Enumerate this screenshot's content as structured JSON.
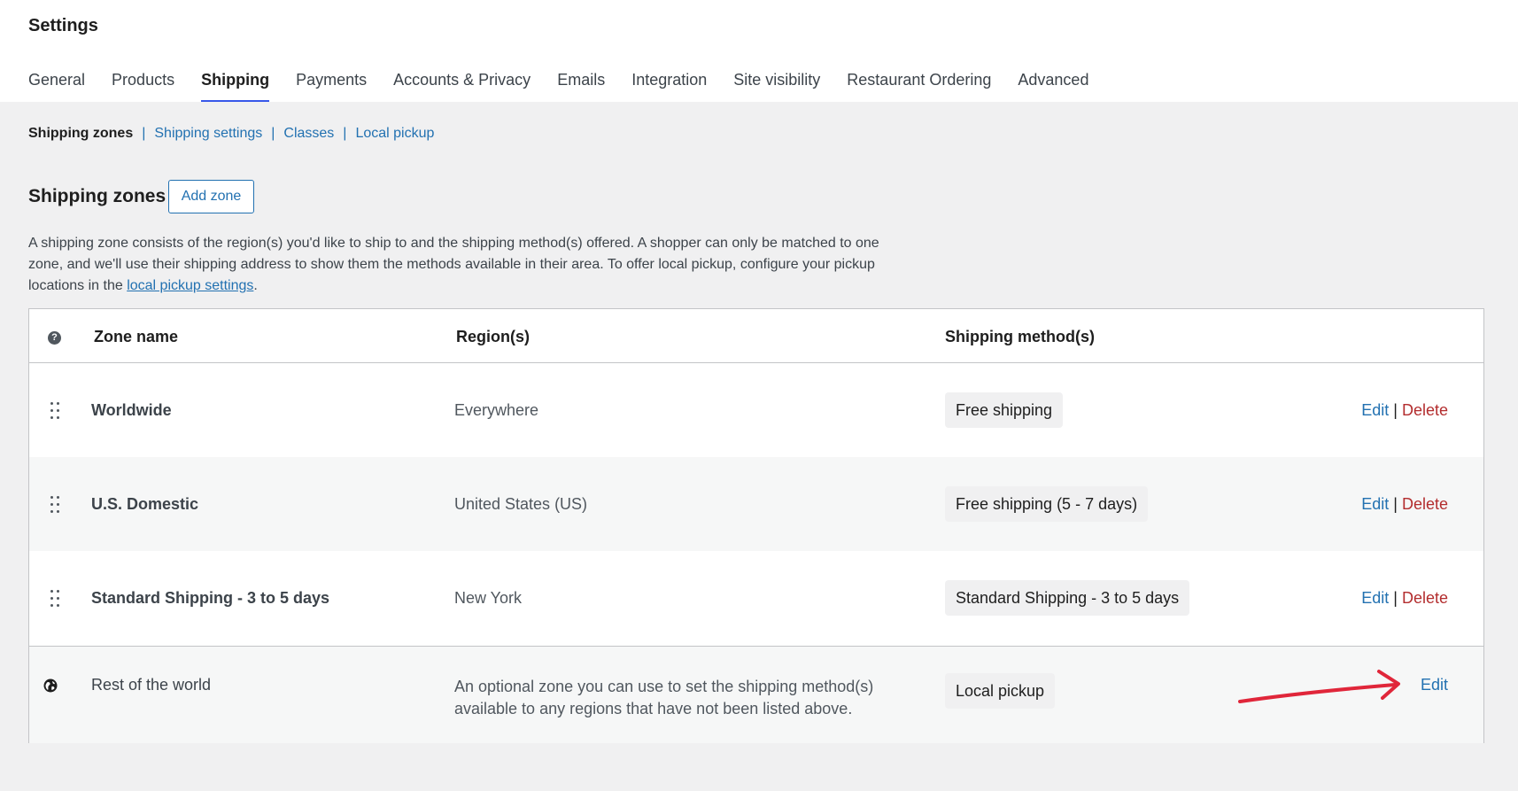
{
  "header": {
    "title": "Settings",
    "tabs": [
      {
        "label": "General"
      },
      {
        "label": "Products"
      },
      {
        "label": "Shipping"
      },
      {
        "label": "Payments"
      },
      {
        "label": "Accounts & Privacy"
      },
      {
        "label": "Emails"
      },
      {
        "label": "Integration"
      },
      {
        "label": "Site visibility"
      },
      {
        "label": "Restaurant Ordering"
      },
      {
        "label": "Advanced"
      }
    ],
    "active_tab": "Shipping"
  },
  "subnav": {
    "current": "Shipping zones",
    "links": [
      "Shipping settings",
      "Classes",
      "Local pickup"
    ]
  },
  "zones": {
    "heading": "Shipping zones",
    "add_zone_label": "Add zone",
    "description_before_link": "A shipping zone consists of the region(s) you'd like to ship to and the shipping method(s) offered. A shopper can only be matched to one zone, and we'll use their shipping address to show them the methods available in their area. To offer local pickup, configure your pickup locations in the ",
    "description_link": "local pickup settings",
    "description_after_link": "."
  },
  "table": {
    "columns": {
      "zone_name": "Zone name",
      "regions": "Region(s)",
      "methods": "Shipping method(s)"
    },
    "rows": [
      {
        "zone_name": "Worldwide",
        "region": "Everywhere",
        "method": "Free shipping",
        "edit": "Edit",
        "delete": "Delete"
      },
      {
        "zone_name": "U.S. Domestic",
        "region": "United States (US)",
        "method": "Free shipping (5 - 7 days)",
        "edit": "Edit",
        "delete": "Delete"
      },
      {
        "zone_name": "Standard Shipping - 3 to 5 days",
        "region": "New York",
        "method": "Standard Shipping - 3 to 5 days",
        "edit": "Edit",
        "delete": "Delete"
      }
    ],
    "rest_of_world": {
      "zone_name": "Rest of the world",
      "region": "An optional zone you can use to set the shipping method(s) available to any regions that have not been listed above.",
      "method": "Local pickup",
      "edit": "Edit"
    }
  },
  "colors": {
    "link": "#2271b1",
    "delete": "#b32d2e",
    "active_tab_underline": "#3858e9",
    "annotation_arrow": "#e0263a"
  },
  "icons": {
    "help": "help-icon",
    "drag": "drag-handle-icon",
    "globe": "globe-icon",
    "annotation": "red-arrow-icon"
  }
}
